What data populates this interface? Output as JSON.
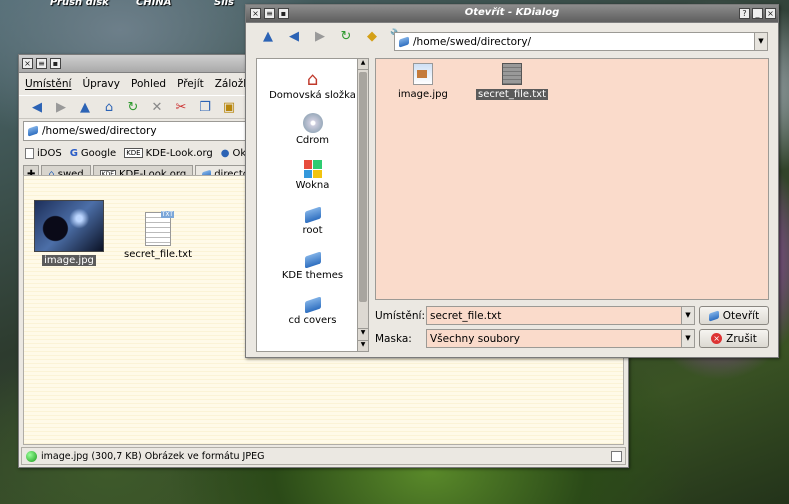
{
  "desktop": {
    "icons": [
      "Přush disk",
      "CHINA",
      "Siis"
    ]
  },
  "konqueror": {
    "menu": [
      "Umístění",
      "Úpravy",
      "Pohled",
      "Přejít",
      "Záložky"
    ],
    "location": "/home/swed/directory",
    "bookmarks": [
      "iDOS",
      "Google",
      "KDE-Look.org",
      "Oká"
    ],
    "tabs": [
      "swed",
      "KDE-Look.org",
      "directo"
    ],
    "files": [
      {
        "name": "image.jpg",
        "icon": "image-thumbnail-icon"
      },
      {
        "name": "secret_file.txt",
        "icon": "text-file-icon"
      }
    ],
    "status": "image.jpg (300,7 KB)  Obrázek ve formátu JPEG"
  },
  "dialog": {
    "title": "Otevřít - KDialog",
    "path": "/home/swed/directory/",
    "places": [
      "Domovská složka",
      "Cdrom",
      "Wokna",
      "root",
      "KDE themes",
      "cd covers"
    ],
    "files": [
      {
        "name": "image.jpg",
        "icon": "image-file-icon"
      },
      {
        "name": "secret_file.txt",
        "icon": "text-file-icon"
      }
    ],
    "location_label": "Umístění:",
    "location_value": "secret_file.txt",
    "filter_label": "Maska:",
    "filter_value": "Všechny soubory",
    "open_label": "Otevřít",
    "cancel_label": "Zrušit"
  },
  "colors": {
    "dialog_view_bg": "#fadbcb",
    "konqueror_view_bg": "#fffae8",
    "titlebar_active": "#5e5e5e"
  }
}
